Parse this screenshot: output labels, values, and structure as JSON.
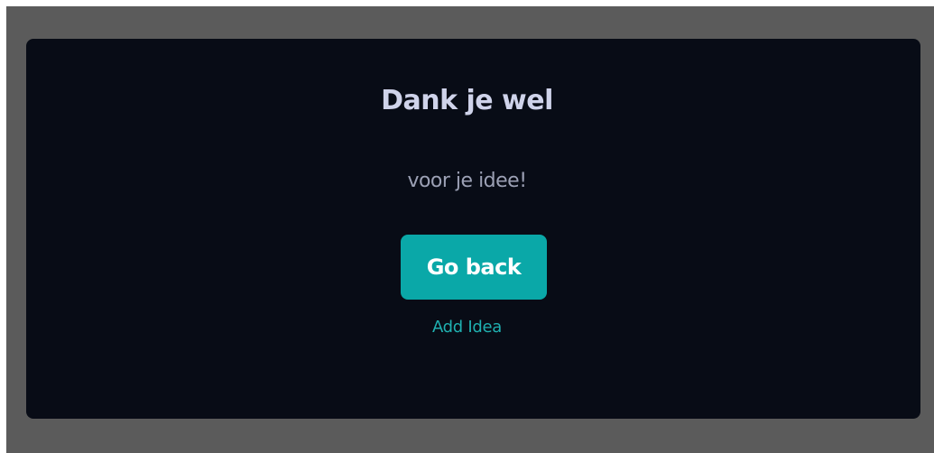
{
  "dialog": {
    "title": "Dank je wel",
    "subtitle": "voor je idee!",
    "primary_button_label": "Go back",
    "secondary_link_label": "Add Idea"
  },
  "colors": {
    "backdrop": "#5b5b5b",
    "dialog_background": "#080c16",
    "title_text": "#cfd3ea",
    "subtitle_text": "#9ca1b5",
    "accent": "#0aa8a8"
  }
}
